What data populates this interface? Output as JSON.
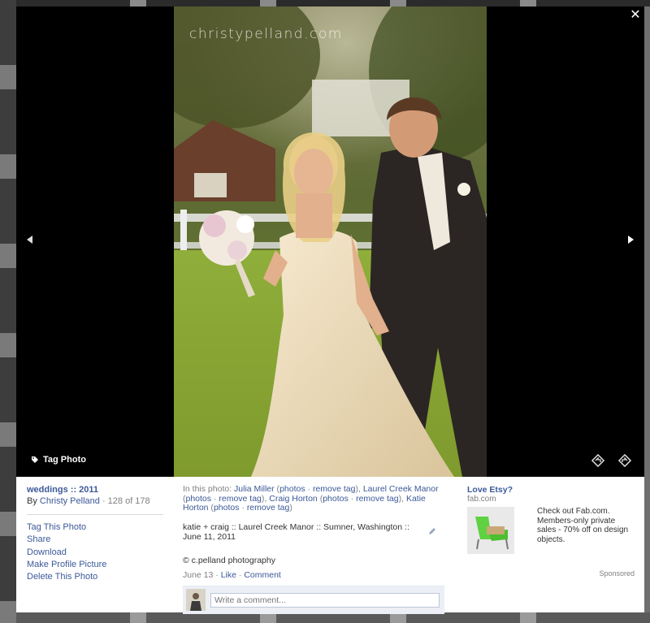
{
  "watermark": "christypelland.com",
  "stage": {
    "tag_photo_label": "Tag Photo",
    "close_glyph": "✕"
  },
  "album": {
    "title": "weddings :: 2011",
    "by_label": "By",
    "owner": "Christy Pelland",
    "count": "· 128 of 178"
  },
  "actions": [
    "Tag This Photo",
    "Share",
    "Download",
    "Make Profile Picture",
    "Delete This Photo"
  ],
  "tags": {
    "prefix": "In this photo:",
    "people": [
      {
        "name": "Julia Miller",
        "photos": "photos",
        "remove": "remove tag"
      },
      {
        "name": "Laurel Creek Manor",
        "photos": "photos",
        "remove": "remove tag"
      },
      {
        "name": "Craig Horton",
        "photos": "photos",
        "remove": "remove tag"
      },
      {
        "name": "Katie Horton",
        "photos": "photos",
        "remove": "remove tag"
      }
    ]
  },
  "caption": "katie + craig :: Laurel Creek Manor :: Sumner, Washington :: June 11, 2011",
  "credit": "© c.pelland photography",
  "meta": {
    "date": "June 13",
    "like": "Like",
    "comment": "Comment"
  },
  "comment_placeholder": "Write a comment...",
  "ad": {
    "title": "Love Etsy?",
    "domain": "fab.com",
    "text": "Check out Fab.com. Members-only private sales - 70% off on design objects.",
    "sponsored": "Sponsored"
  },
  "colors": {
    "link": "#3b5998",
    "stage": "#000000",
    "comment_bg": "#eceff5"
  }
}
